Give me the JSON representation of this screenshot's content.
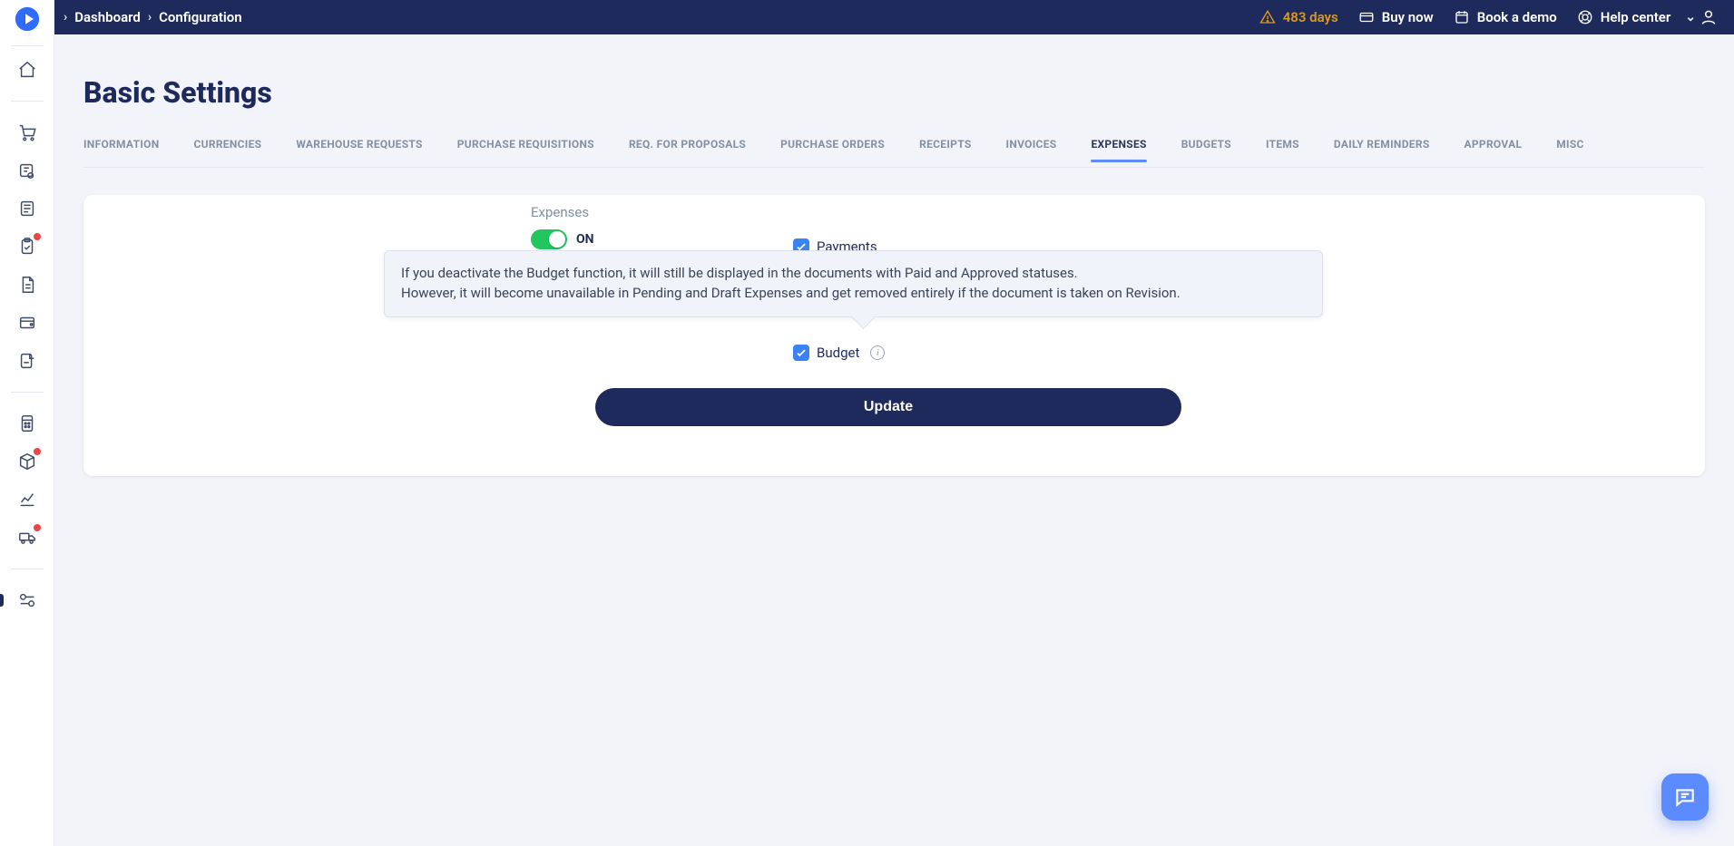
{
  "topbar": {
    "breadcrumbs": [
      "Dashboard",
      "Configuration"
    ],
    "trial_days": "483 days",
    "buy_now": "Buy now",
    "book_demo": "Book a demo",
    "help_center": "Help center"
  },
  "page": {
    "title": "Basic Settings"
  },
  "tabs": [
    "INFORMATION",
    "CURRENCIES",
    "WAREHOUSE REQUESTS",
    "PURCHASE REQUISITIONS",
    "REQ. FOR PROPOSALS",
    "PURCHASE ORDERS",
    "RECEIPTS",
    "INVOICES",
    "EXPENSES",
    "BUDGETS",
    "ITEMS",
    "DAILY REMINDERS",
    "APPROVAL",
    "MISC"
  ],
  "active_tab_index": 8,
  "expenses": {
    "section_label": "Expenses",
    "toggle_state": "ON",
    "payments_label": "Payments",
    "payments_checked": true,
    "budget_label": "Budget",
    "budget_checked": true,
    "budget_tooltip_line1": "If you deactivate the Budget function, it will still be displayed in the documents with Paid and Approved statuses.",
    "budget_tooltip_line2": "However, it will become unavailable in Pending and Draft Expenses and get removed entirely if the document is taken on Revision."
  },
  "update_button": "Update",
  "sidebar": {
    "items": [
      {
        "name": "home-icon",
        "dot": false
      },
      {
        "name": "cart-icon",
        "dot": false
      },
      {
        "name": "vendor-icon",
        "dot": false
      },
      {
        "name": "receipt-icon",
        "dot": false
      },
      {
        "name": "clipboard-icon",
        "dot": true
      },
      {
        "name": "document-icon",
        "dot": false
      },
      {
        "name": "wallet-icon",
        "dot": false
      },
      {
        "name": "file-icon",
        "dot": false
      },
      {
        "name": "calculator-icon",
        "dot": false
      },
      {
        "name": "box-icon",
        "dot": true
      },
      {
        "name": "chart-icon",
        "dot": false
      },
      {
        "name": "truck-icon",
        "dot": true
      },
      {
        "name": "integrations-icon",
        "dot": false,
        "active": true
      }
    ]
  }
}
